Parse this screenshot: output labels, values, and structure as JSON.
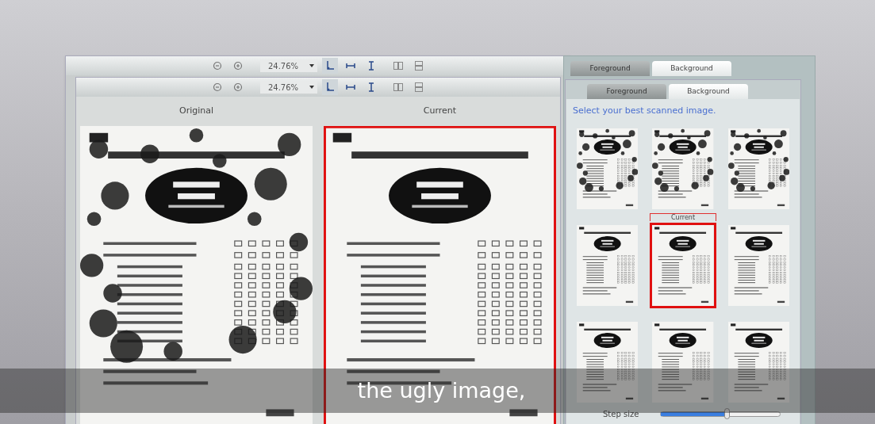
{
  "back_window": {
    "toolbar": {
      "zoom": "24.76%"
    }
  },
  "viewer": {
    "toolbar": {
      "zoom": "24.76%"
    },
    "panes": [
      {
        "title": "Original",
        "selected": false,
        "noisy": true
      },
      {
        "title": "Current",
        "selected": true,
        "noisy": false
      }
    ]
  },
  "back_panel": {
    "tabs": [
      {
        "label": "Foreground",
        "selected": false
      },
      {
        "label": "Background",
        "selected": true
      }
    ]
  },
  "panel": {
    "tabs": [
      {
        "label": "Foreground",
        "selected": false
      },
      {
        "label": "Background",
        "selected": true
      }
    ],
    "prompt": "Select your best scanned image.",
    "current_label": "Current",
    "thumbnails": [
      {
        "selected": false,
        "noisy": true
      },
      {
        "selected": false,
        "noisy": true
      },
      {
        "selected": false,
        "noisy": true
      },
      {
        "selected": false,
        "noisy": false
      },
      {
        "selected": true,
        "noisy": false
      },
      {
        "selected": false,
        "noisy": false
      },
      {
        "selected": false,
        "noisy": false
      },
      {
        "selected": false,
        "noisy": false
      },
      {
        "selected": false,
        "noisy": false
      }
    ],
    "step_size": {
      "label": "Step size",
      "level": 0.55
    }
  },
  "subtitle": "the ugly image,"
}
